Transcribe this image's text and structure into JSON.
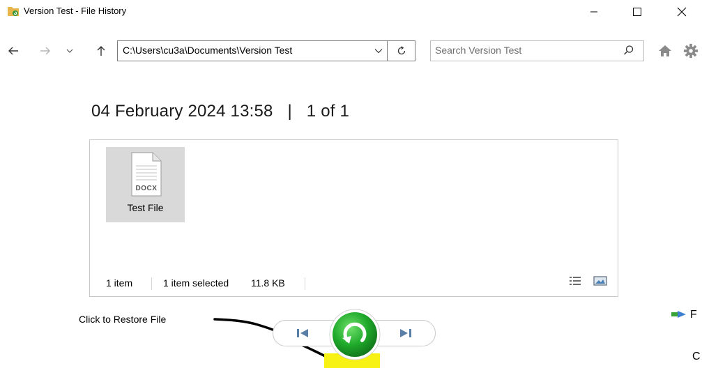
{
  "window": {
    "title": "Version Test - File History"
  },
  "address": {
    "path": "C:\\Users\\cu3a\\Documents\\Version Test"
  },
  "search": {
    "placeholder": "Search Version Test"
  },
  "header": {
    "date": "04 February 2024 13:58",
    "separator": "|",
    "position": "1 of 1"
  },
  "file": {
    "type_badge": "DOCX",
    "name": "Test File"
  },
  "status": {
    "item_count": "1 item",
    "selection": "1 item selected",
    "size": "11.8 KB"
  },
  "annotation": {
    "label": "Click to Restore File"
  },
  "side": {
    "partial_label": "F",
    "partial_label_2": "C"
  },
  "colors": {
    "restore_green": "#1faa2b",
    "highlight_yellow": "#f8f214",
    "nav_blue": "#5a7fa6"
  },
  "icons": {
    "app": "folder-history-icon",
    "search": "search-icon",
    "home": "home-icon",
    "settings": "gear-icon",
    "restore": "restore-icon",
    "previous": "previous-version-icon",
    "next": "next-version-icon"
  }
}
